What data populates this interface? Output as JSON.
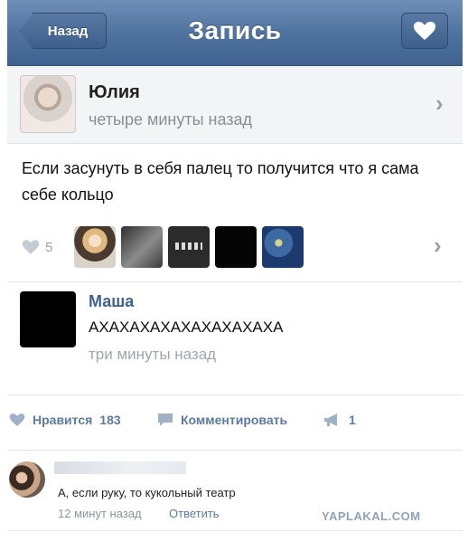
{
  "navbar": {
    "back_label": "Назад",
    "title": "Запись",
    "like_icon": "heart-icon"
  },
  "author": {
    "name": "Юлия",
    "time": "четыре минуты назад"
  },
  "post": {
    "text": "Если засунуть в себя палец то получится что я сама себе кольцо"
  },
  "likes": {
    "count": "5",
    "icon": "heart-icon"
  },
  "top_comment": {
    "name": "Маша",
    "text": "АХАХАХАХАХАХАХАХАХА",
    "time": "три минуты назад"
  },
  "actions": {
    "like_label": "Нравится",
    "like_count": "183",
    "comment_label": "Комментировать",
    "repost_count": "1"
  },
  "comment": {
    "text": "А, если руку, то кукольный театр",
    "time": "12 минут назад",
    "reply_label": "Ответить"
  },
  "watermark": "YAPLAKAL.COM",
  "colors": {
    "nav": "#50739f",
    "link": "#3f6290",
    "muted": "#9aa3ad"
  }
}
